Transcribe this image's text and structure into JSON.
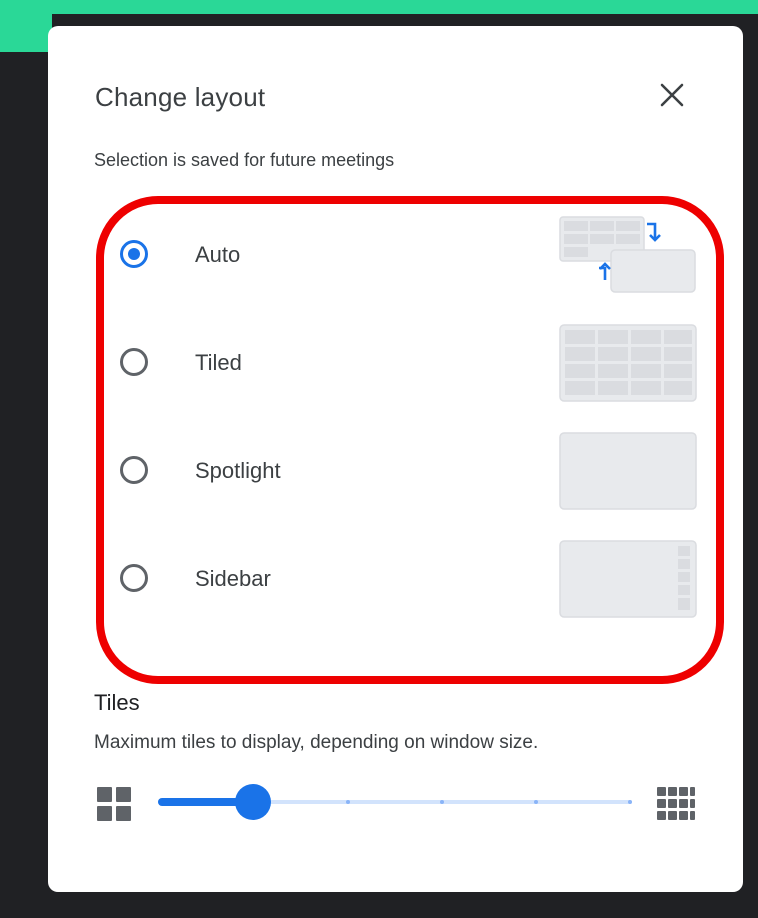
{
  "dialog": {
    "title": "Change layout",
    "subtitle": "Selection is saved for future meetings",
    "close_icon": "close-icon"
  },
  "layout_options": [
    {
      "label": "Auto",
      "selected": true,
      "thumbnail_icon": "auto-layout-thumbnail"
    },
    {
      "label": "Tiled",
      "selected": false,
      "thumbnail_icon": "tiled-layout-thumbnail"
    },
    {
      "label": "Spotlight",
      "selected": false,
      "thumbnail_icon": "spotlight-layout-thumbnail"
    },
    {
      "label": "Sidebar",
      "selected": false,
      "thumbnail_icon": "sidebar-layout-thumbnail"
    }
  ],
  "tiles": {
    "title": "Tiles",
    "description": "Maximum tiles to display, depending on window size.",
    "min_icon": "grid-small-icon",
    "max_icon": "grid-large-icon",
    "slider_value": 0.2,
    "tick_count": 6
  },
  "colors": {
    "accent": "#1a73e8",
    "highlight": "#ee0000",
    "background": "#202124"
  }
}
